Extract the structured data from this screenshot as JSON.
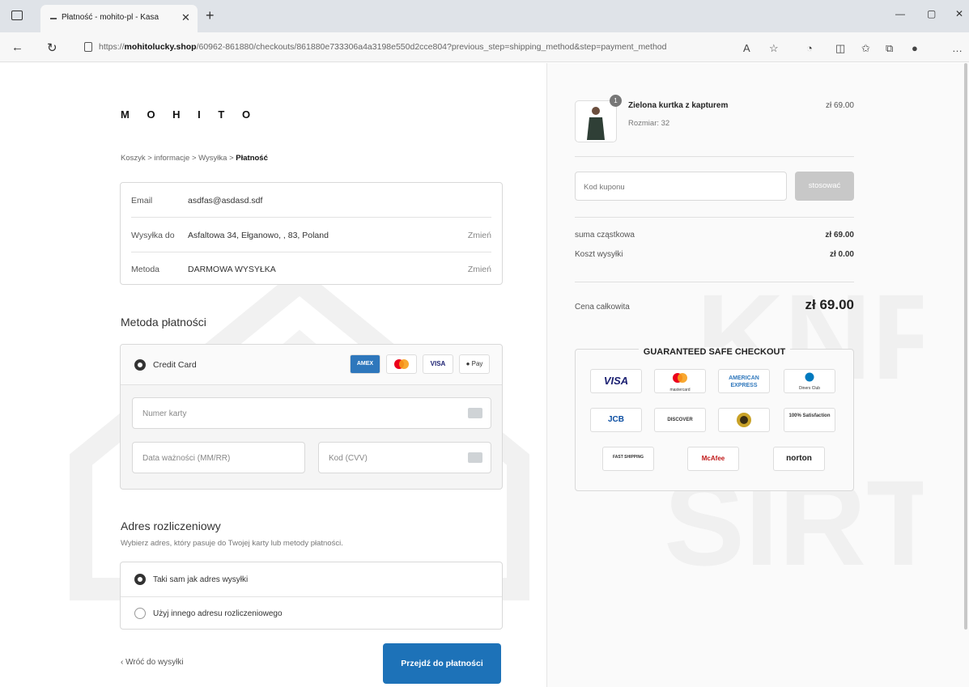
{
  "browser": {
    "tab_title": "Płatność - mohito-pl - Kasa",
    "url_prefix": "https://",
    "url_host": "mohitolucky.shop",
    "url_path": "/60962-861880/checkouts/861880e733306a4a3198e550d2cce804?previous_step=shipping_method&step=payment_method"
  },
  "brand": {
    "logo": "M O H I T O"
  },
  "breadcrumb": {
    "items": [
      "Koszyk",
      "informacje",
      "Wysyłka"
    ],
    "separator": ">",
    "current": "Płatność"
  },
  "info": {
    "rows": [
      {
        "label": "Email",
        "value": "asdfas@asdasd.sdf",
        "action": ""
      },
      {
        "label": "Wysyłka do",
        "value": "Asfaltowa 34, Ełganowo, , 83, Poland",
        "action": "Zmień"
      },
      {
        "label": "Metoda",
        "value": "DARMOWA WYSYŁKA",
        "action": "Zmień"
      }
    ]
  },
  "payment": {
    "title": "Metoda płatności",
    "option_label": "Credit Card",
    "card_logos": [
      "AMEX",
      "MC",
      "VISA",
      "Pay"
    ],
    "card_number_placeholder": "Numer karty",
    "expiry_placeholder": "Data ważności (MM/RR)",
    "cvv_placeholder": "Kod (CVV)"
  },
  "billing": {
    "title": "Adres rozliczeniowy",
    "subtitle": "Wybierz adres, który pasuje do Twojej karty lub metody płatności.",
    "options": [
      "Taki sam jak adres wysyłki",
      "Użyj innego adresu rozliczeniowego"
    ]
  },
  "actions": {
    "back": "Wróć do wysyłki",
    "pay": "Przejdź do płatności"
  },
  "summary": {
    "qty": "1",
    "product_name": "Zielona kurtka z kapturem",
    "product_size": "Rozmiar: 32",
    "product_price": "zł 69.00",
    "coupon_placeholder": "Kod kuponu",
    "coupon_button": "stosować",
    "subtotal_label": "suma cząstkowa",
    "subtotal_value": "zł 69.00",
    "shipping_label": "Koszt wysyłki",
    "shipping_value": "zł 0.00",
    "total_label": "Cena całkowita",
    "total_value": "zł 69.00"
  },
  "safe_checkout": {
    "title": "GUARANTEED SAFE CHECKOUT",
    "badges": [
      "VISA",
      "mastercard",
      "AMERICAN EXPRESS",
      "Diners Club",
      "JCB",
      "DISCOVER",
      "",
      "100% Satisfaction",
      "FAST SHIPPING",
      "McAfee",
      "norton"
    ]
  },
  "colors": {
    "accent": "#1d72b8",
    "coupon_button": "#c8c8c8"
  }
}
